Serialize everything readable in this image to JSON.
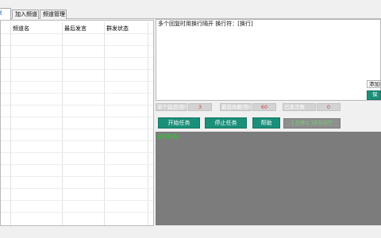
{
  "tabs": [
    "发",
    "加入频道",
    "频道管理"
  ],
  "grid": {
    "columns": [
      "频道名",
      "最后发言",
      "群发状态"
    ],
    "rows": []
  },
  "message": {
    "text": "多个回复时用换行隔开  换行符：[换行]"
  },
  "side_buttons": {
    "add": "添加频",
    "save": "保"
  },
  "params": [
    {
      "label": "单个延迟(秒)",
      "value": "3"
    },
    {
      "label": "最低休眠(秒)",
      "value": "60"
    },
    {
      "label": "已发次数",
      "value": "0"
    }
  ],
  "buttons": {
    "start": "开始任务",
    "stop": "停止任务",
    "help": "帮助",
    "status": "[ 已停止 ]正在运行"
  },
  "console": {
    "line": "运行日志:"
  },
  "colors": {
    "accent": "#1b8f7a",
    "value_red": "#d23c3c",
    "log_green": "#19e019",
    "console_bg": "#7c7c7c"
  }
}
